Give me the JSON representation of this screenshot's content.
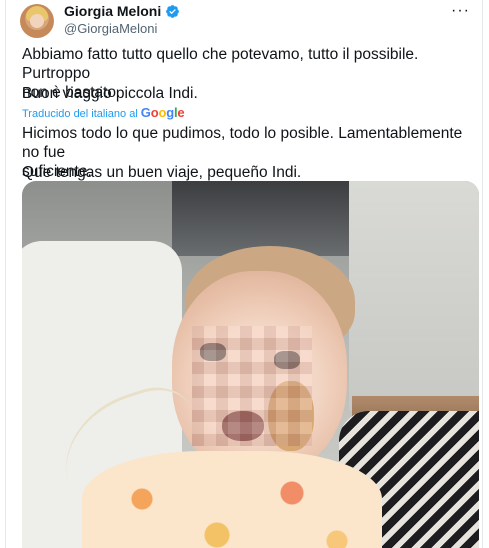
{
  "user": {
    "display_name": "Giorgia Meloni",
    "handle": "@GiorgiaMeloni",
    "verified_icon": "verified-badge-icon",
    "more_label": "···"
  },
  "tweet": {
    "original_line1": "Abbiamo fatto tutto quello che potevamo, tutto il possibile. Purtroppo\nnon è bastato.",
    "original_line2": "Buon viaggio piccola Indi.",
    "translated_prefix": "Traducido del italiano al",
    "translated_provider_letters": [
      "G",
      "o",
      "o",
      "g",
      "l",
      "e"
    ],
    "translation_line1": "Hicimos todo lo que pudimos, todo lo posible. Lamentablemente no fue\nsuficiente.",
    "translation_line2": "Que tengas un buen viaje, pequeño Indi."
  },
  "colors": {
    "text": "#0f1419",
    "secondary": "#536471",
    "accent": "#1d9bf0"
  }
}
